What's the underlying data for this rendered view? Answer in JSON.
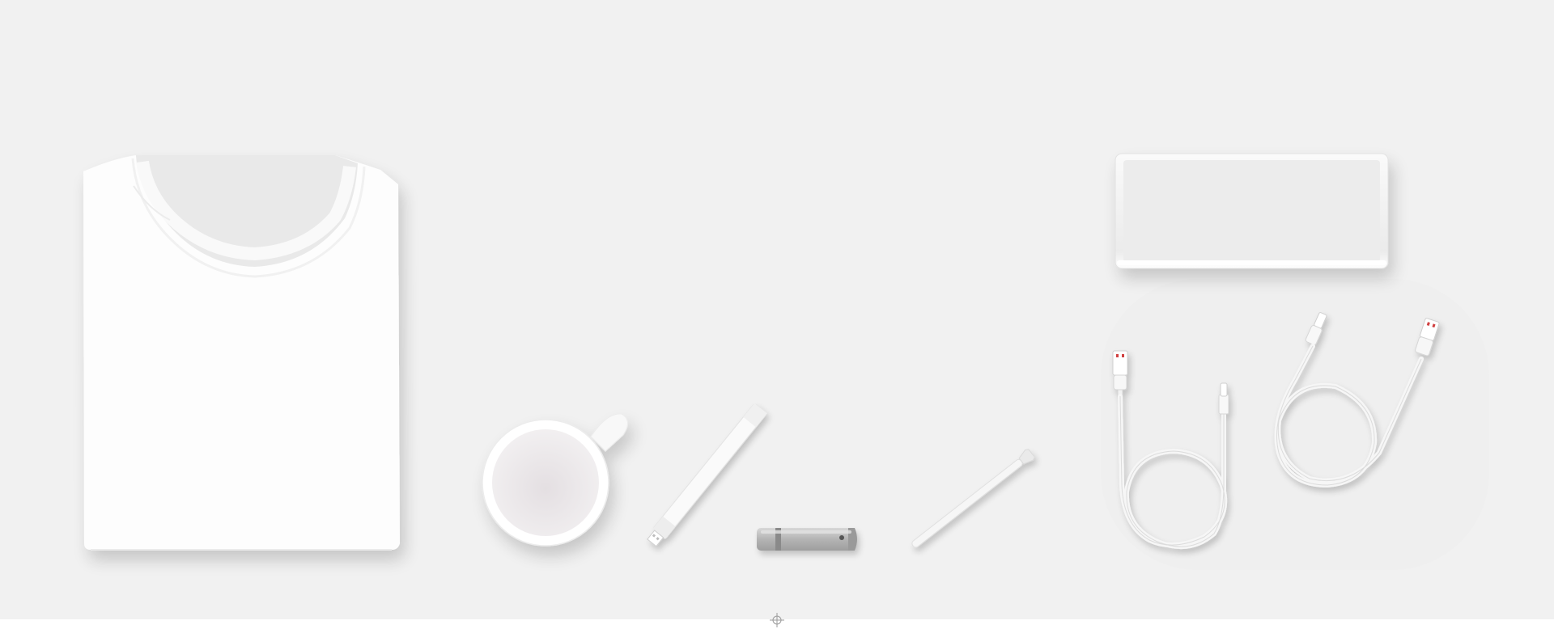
{
  "scene": {
    "background_color": "#f1f1f1",
    "objects": [
      {
        "name": "folded-tshirt",
        "color": "#fdfdfd"
      },
      {
        "name": "coffee-mug",
        "color": "#ffffff"
      },
      {
        "name": "usb-stick-white",
        "color": "#fafafa"
      },
      {
        "name": "usb-flash-drive-grey",
        "color": "#b9b9b9"
      },
      {
        "name": "pen",
        "color": "#f6f6f6"
      },
      {
        "name": "power-bank",
        "color": "#efefef"
      },
      {
        "name": "usb-cable-coiled",
        "color": "#fafafa"
      }
    ],
    "marker_icon": "crosshair-icon"
  }
}
